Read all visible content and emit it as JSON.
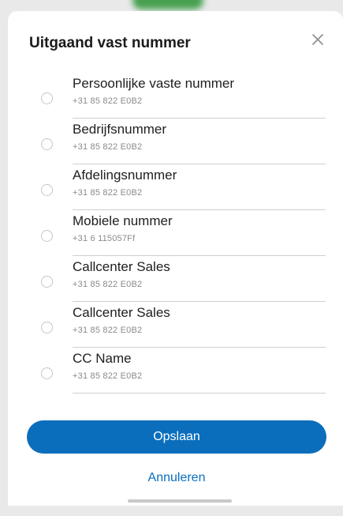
{
  "dialog": {
    "title": "Uitgaand vast nummer",
    "close_icon": "close-icon"
  },
  "options": [
    {
      "label": "Persoonlijke vaste nummer",
      "number": "+31 85 822 E0B2",
      "selected": false
    },
    {
      "label": "Bedrijfsnummer",
      "number": "+31 85 822 E0B2",
      "selected": false
    },
    {
      "label": "Afdelingsnummer",
      "number": "+31 85 822 E0B2",
      "selected": false
    },
    {
      "label": "Mobiele nummer",
      "number": "+31 6 115057Ff",
      "selected": false
    },
    {
      "label": "Callcenter Sales",
      "number": "+31 85 822 E0B2",
      "selected": false
    },
    {
      "label": "Callcenter Sales",
      "number": "+31 85 822 E0B2",
      "selected": false
    },
    {
      "label": "CC Name",
      "number": "+31 85 822 E0B2",
      "selected": false
    }
  ],
  "actions": {
    "save_label": "Opslaan",
    "cancel_label": "Annuleren"
  },
  "colors": {
    "accent": "#0a6ebd",
    "radio_border": "#c6c6c6",
    "divider": "#cfcfcf"
  }
}
